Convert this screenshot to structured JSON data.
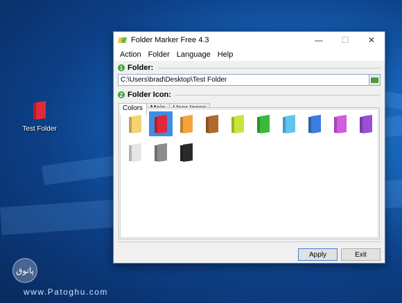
{
  "desktop": {
    "icon_label": "Test Folder",
    "icon_color": "#e0293a",
    "watermark": "www.Patoghu.com",
    "logo_text": "پاتوق"
  },
  "window": {
    "title": "Folder Marker Free 4.3",
    "controls": {
      "minimize": "—",
      "maximize": "☐",
      "close": "✕"
    },
    "menu": [
      "Action",
      "Folder",
      "Language",
      "Help"
    ],
    "folder_section": {
      "number": "1",
      "label": "Folder:"
    },
    "folder_path": "C:\\Users\\brad\\Desktop\\Test Folder",
    "icon_section": {
      "number": "2",
      "label": "Folder Icon:"
    },
    "tabs": [
      "Colors",
      "Main",
      "User Icons"
    ],
    "active_tab": "Colors",
    "selected_color": "red",
    "colors": [
      {
        "name": "yellow",
        "hex": "#f5d372"
      },
      {
        "name": "red",
        "hex": "#e0293a"
      },
      {
        "name": "orange",
        "hex": "#f4a33f"
      },
      {
        "name": "brown",
        "hex": "#b06a2e"
      },
      {
        "name": "lime",
        "hex": "#c8e63a"
      },
      {
        "name": "green",
        "hex": "#3cb83c"
      },
      {
        "name": "light-blue",
        "hex": "#5fc4ef"
      },
      {
        "name": "blue",
        "hex": "#3b7de0"
      },
      {
        "name": "pink",
        "hex": "#d45be0"
      },
      {
        "name": "purple",
        "hex": "#9a4fd4"
      },
      {
        "name": "white",
        "hex": "#e6e6e6"
      },
      {
        "name": "gray",
        "hex": "#8c8c8c"
      },
      {
        "name": "black",
        "hex": "#2a2a2a"
      }
    ],
    "buttons": {
      "apply": "Apply",
      "exit": "Exit"
    }
  }
}
